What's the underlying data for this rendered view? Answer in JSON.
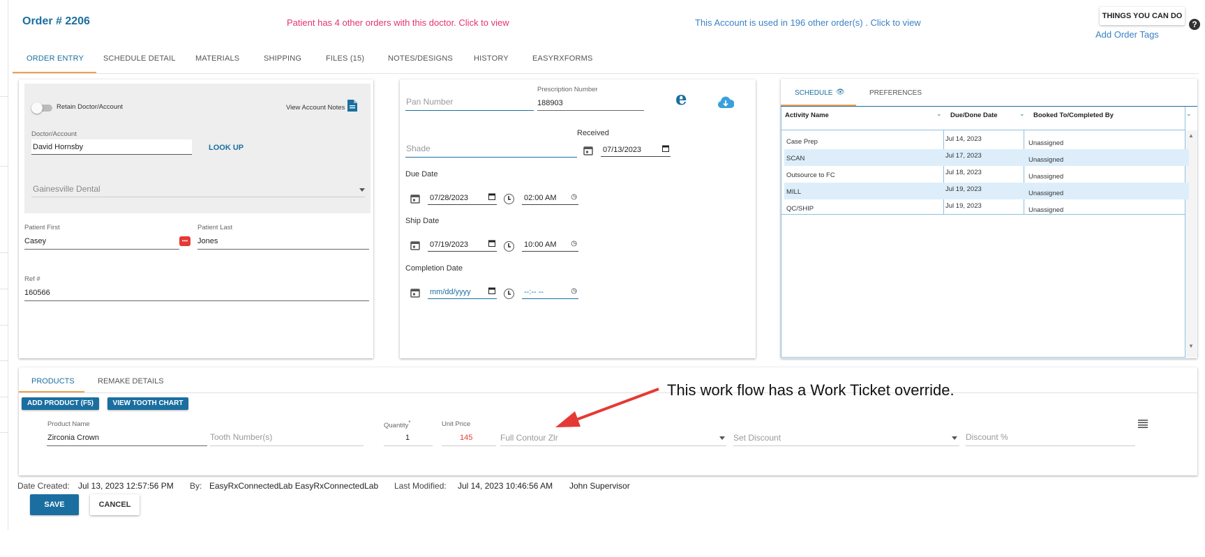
{
  "header": {
    "order_title": "Order # 2206",
    "patient_message": "Patient has 4 other orders with this doctor. Click to view",
    "account_message": "This Account is used in 196 other order(s) . Click to view",
    "things_button": "THINGS YOU CAN DO",
    "add_tags": "Add Order Tags",
    "help_icon": "?"
  },
  "tabs": [
    "ORDER ENTRY",
    "SCHEDULE DETAIL",
    "MATERIALS",
    "SHIPPING",
    "FILES (15)",
    "NOTES/DESIGNS",
    "HISTORY",
    "EASYRXFORMS"
  ],
  "doctor_panel": {
    "retain_label": "Retain Doctor/Account",
    "view_notes": "View Account Notes",
    "doctor_label": "Doctor/Account",
    "doctor_value": "David Hornsby",
    "lookup": "LOOK UP",
    "practice": "Gainesville Dental",
    "patient_first_label": "Patient First",
    "patient_first": "Casey",
    "patient_last_label": "Patient Last",
    "patient_last": "Jones",
    "ref_label": "Ref #",
    "ref_value": "160566"
  },
  "dates_panel": {
    "pan_placeholder": "Pan Number",
    "rx_label": "Prescription Number",
    "rx_value": "188903",
    "e_icon": "e",
    "shade_placeholder": "Shade",
    "received_label": "Received",
    "received_date": "07/13/2023",
    "due_label": "Due Date",
    "due_date": "07/28/2023",
    "due_time": "02:00 AM",
    "ship_label": "Ship Date",
    "ship_date": "07/19/2023",
    "ship_time": "10:00 AM",
    "completion_label": "Completion Date",
    "completion_date": "mm/dd/yyyy",
    "completion_time": "--:-- --"
  },
  "schedule": {
    "tab_schedule": "SCHEDULE",
    "tab_preferences": "PREFERENCES",
    "col_activity": "Activity Name",
    "col_due": "Due/Done Date",
    "col_booked": "Booked To/Completed By",
    "rows": [
      {
        "activity": "Case Prep",
        "date": "Jul 14, 2023",
        "booked": "Unassigned"
      },
      {
        "activity": "SCAN",
        "date": "Jul 17, 2023",
        "booked": "Unassigned"
      },
      {
        "activity": "Outsource to FC",
        "date": "Jul 18, 2023",
        "booked": "Unassigned"
      },
      {
        "activity": "MILL",
        "date": "Jul 19, 2023",
        "booked": "Unassigned"
      },
      {
        "activity": "QC/SHIP",
        "date": "Jul 19, 2023",
        "booked": "Unassigned"
      }
    ]
  },
  "products": {
    "tab_products": "PRODUCTS",
    "tab_remake": "REMAKE DETAILS",
    "add_product": "ADD PRODUCT (F5)",
    "view_tooth_chart": "VIEW TOOTH CHART",
    "product_name_label": "Product Name",
    "product_name": "Zirconia Crown",
    "tooth_placeholder": "Tooth Number(s)",
    "quantity_label": "Quantity",
    "required_mark": "*",
    "quantity": "1",
    "unit_price_label": "Unit Price",
    "unit_price": "145",
    "material": "Full Contour Zlr",
    "discount_placeholder": "Set Discount",
    "discount_pct_placeholder": "Discount %"
  },
  "annotation": "This work flow has a Work Ticket override.",
  "footer": {
    "date_created_label": "Date Created:",
    "date_created": "Jul 13, 2023 12:57:56 PM",
    "by_label": "By:",
    "by_value": "EasyRxConnectedLab EasyRxConnectedLab",
    "modified_label": "Last Modified:",
    "modified_value": "Jul 14, 2023 10:46:56 AM",
    "modified_by": "John Supervisor",
    "save": "SAVE",
    "cancel": "CANCEL"
  },
  "colors": {
    "accent": "#1a6fa0",
    "patient_message": "#e5336d",
    "account_message": "#3b82c4",
    "price": "#e53935",
    "arrow": "#e53935",
    "tab_underline": "#f0a050",
    "row_highlight": "#ddeefa"
  }
}
